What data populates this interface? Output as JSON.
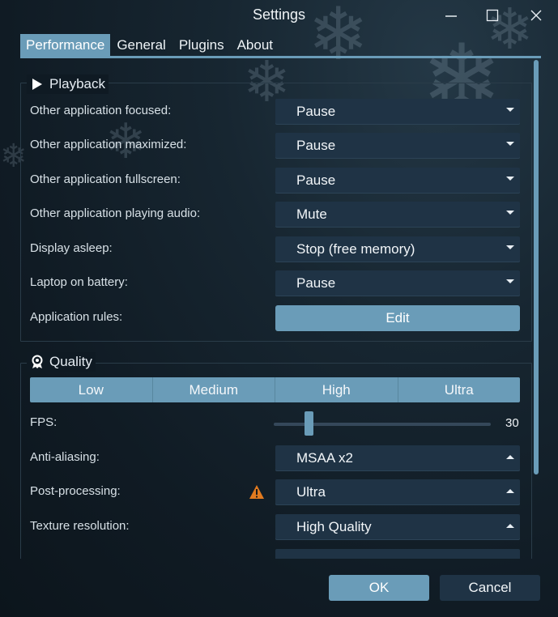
{
  "window": {
    "title": "Settings"
  },
  "tabs": [
    {
      "label": "Performance",
      "active": true
    },
    {
      "label": "General"
    },
    {
      "label": "Plugins"
    },
    {
      "label": "About"
    }
  ],
  "playback": {
    "title": "Playback",
    "rows": [
      {
        "label": "Other application focused:",
        "value": "Pause"
      },
      {
        "label": "Other application maximized:",
        "value": "Pause"
      },
      {
        "label": "Other application fullscreen:",
        "value": "Pause"
      },
      {
        "label": "Other application playing audio:",
        "value": "Mute"
      },
      {
        "label": "Display asleep:",
        "value": "Stop (free memory)"
      },
      {
        "label": "Laptop on battery:",
        "value": "Pause"
      }
    ],
    "rules": {
      "label": "Application rules:",
      "button": "Edit"
    }
  },
  "quality": {
    "title": "Quality",
    "presets": [
      "Low",
      "Medium",
      "High",
      "Ultra"
    ],
    "fps": {
      "label": "FPS:",
      "value": "30",
      "level": 0.15
    },
    "anti_aliasing": {
      "label": "Anti-aliasing:",
      "value": "MSAA x2"
    },
    "post_processing": {
      "label": "Post-processing:",
      "value": "Ultra"
    },
    "texture_resolution": {
      "label": "Texture resolution:",
      "value": "High Quality"
    }
  },
  "footer": {
    "ok": "OK",
    "cancel": "Cancel"
  },
  "colors": {
    "accent": "#6a9cb8",
    "combo_bg": "#1f3345",
    "warning": "#e07a1f"
  }
}
